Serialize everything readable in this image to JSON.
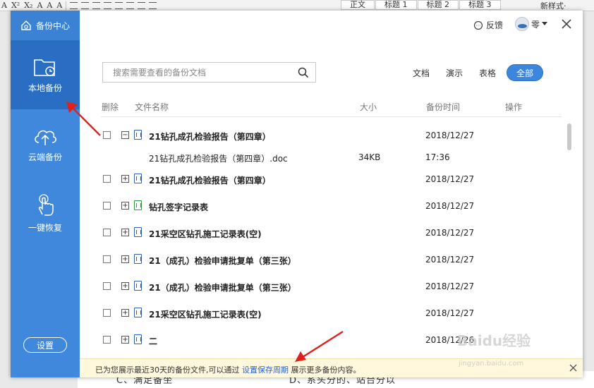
{
  "ribbon": {
    "format_icons": [
      "A",
      "X²",
      "X₂",
      "A",
      "A",
      "A"
    ],
    "styles": [
      "正文",
      "标题 1",
      "标题 2",
      "标题 3"
    ],
    "new_style": "新样式·"
  },
  "background_doc": {
    "text_left": "C、满足备坐",
    "text_right": "D、系头分的、站台分以"
  },
  "sidebar": {
    "title": "备份中心",
    "nav": [
      {
        "label": "本地备份",
        "icon": "local-folder-clock-icon",
        "active": true
      },
      {
        "label": "云端备份",
        "icon": "cloud-upload-icon",
        "active": false
      },
      {
        "label": "一键恢复",
        "icon": "hand-tap-icon",
        "active": false
      }
    ],
    "settings_label": "设置"
  },
  "topbar": {
    "feedback_label": "反馈",
    "user_name": "零"
  },
  "search": {
    "placeholder": "搜索需要查看的备份文档"
  },
  "filters": [
    "文档",
    "演示",
    "表格"
  ],
  "filter_all": "全部",
  "table": {
    "headers": {
      "delete": "删除",
      "name": "文件名称",
      "size": "大小",
      "time": "备份时间",
      "action": "操作"
    },
    "rows": [
      {
        "name": "21钻孔成孔检验报告（第四章）",
        "date": "2018/12/27",
        "expander": "−",
        "icon": "word-doc-icon"
      },
      {
        "name": "21钻孔成孔检验报告（第四章）.doc",
        "size": "34KB",
        "date": "17:36",
        "sub": true
      },
      {
        "name": "21钻孔成孔检验报告（第四章）",
        "date": "2018/12/27",
        "expander": "+",
        "icon": "word-doc-icon"
      },
      {
        "name": "钻孔签字记录表",
        "date": "2018/12/27",
        "expander": "+",
        "icon": "excel-doc-icon"
      },
      {
        "name": "21采空区钻孔施工记录表(空)",
        "date": "2018/12/27",
        "expander": "+",
        "icon": "word-doc-icon"
      },
      {
        "name": "21（成孔）检验申请批复单（第三张）",
        "date": "2018/12/27",
        "expander": "+",
        "icon": "word-doc-icon"
      },
      {
        "name": "21（成孔）检验申请批复单（第三张）",
        "date": "2018/12/27",
        "expander": "+",
        "icon": "word-doc-icon"
      },
      {
        "name": "21采空区钻孔施工记录表(空)",
        "date": "2018/12/27",
        "expander": "+",
        "icon": "word-doc-icon"
      },
      {
        "name": "二",
        "date": "2018/12/26",
        "expander": "+",
        "icon": "word-doc-icon"
      }
    ]
  },
  "notice": {
    "text_before": "已为您展示最近30天的备份文件,可以通过",
    "link": "设置保存周期",
    "text_after": "展示更多备份内容。"
  },
  "watermark": {
    "logo": "Baidu经验",
    "sub": "jingyan.baidu.com"
  },
  "colors": {
    "sidebar": "#4088dc",
    "sidebar_active": "#2a6ec3",
    "accent": "#3d86e0",
    "arrow": "#e0201c",
    "notice_bg": "#fff8dc",
    "link": "#2a63c9"
  }
}
